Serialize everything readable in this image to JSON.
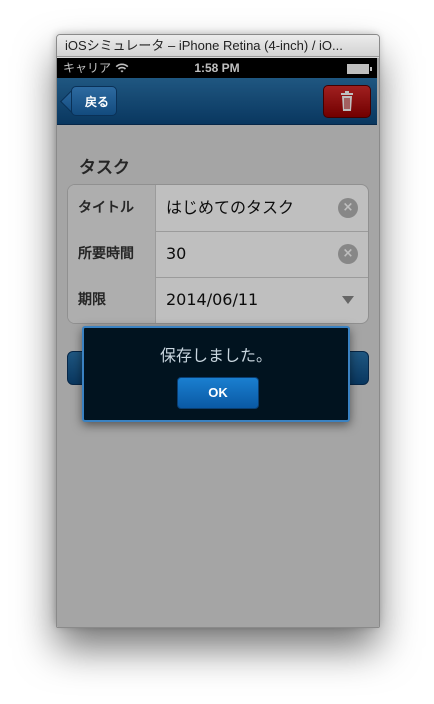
{
  "window": {
    "title": "iOSシミュレータ – iPhone Retina (4-inch) / iO..."
  },
  "status_bar": {
    "carrier": "キャリア",
    "wifi_icon": "wifi-icon",
    "time": "1:58 PM",
    "battery_icon": "battery-icon"
  },
  "nav": {
    "back_label": "戻る",
    "trash_icon": "trash-icon"
  },
  "section": {
    "title": "タスク"
  },
  "form": {
    "rows": [
      {
        "label": "タイトル",
        "value": "はじめてのタスク",
        "accessory": "clear-icon"
      },
      {
        "label": "所要時間",
        "value": "30",
        "accessory": "clear-icon"
      },
      {
        "label": "期限",
        "value": "2014/06/11",
        "accessory": "chevron-down-icon"
      }
    ]
  },
  "alert": {
    "message": "保存しました。",
    "ok_label": "OK"
  },
  "colors": {
    "nav_blue": "#0d4a80",
    "trash_red": "#b00000",
    "alert_bg": "#01131f",
    "alert_border": "#3a82c2"
  }
}
